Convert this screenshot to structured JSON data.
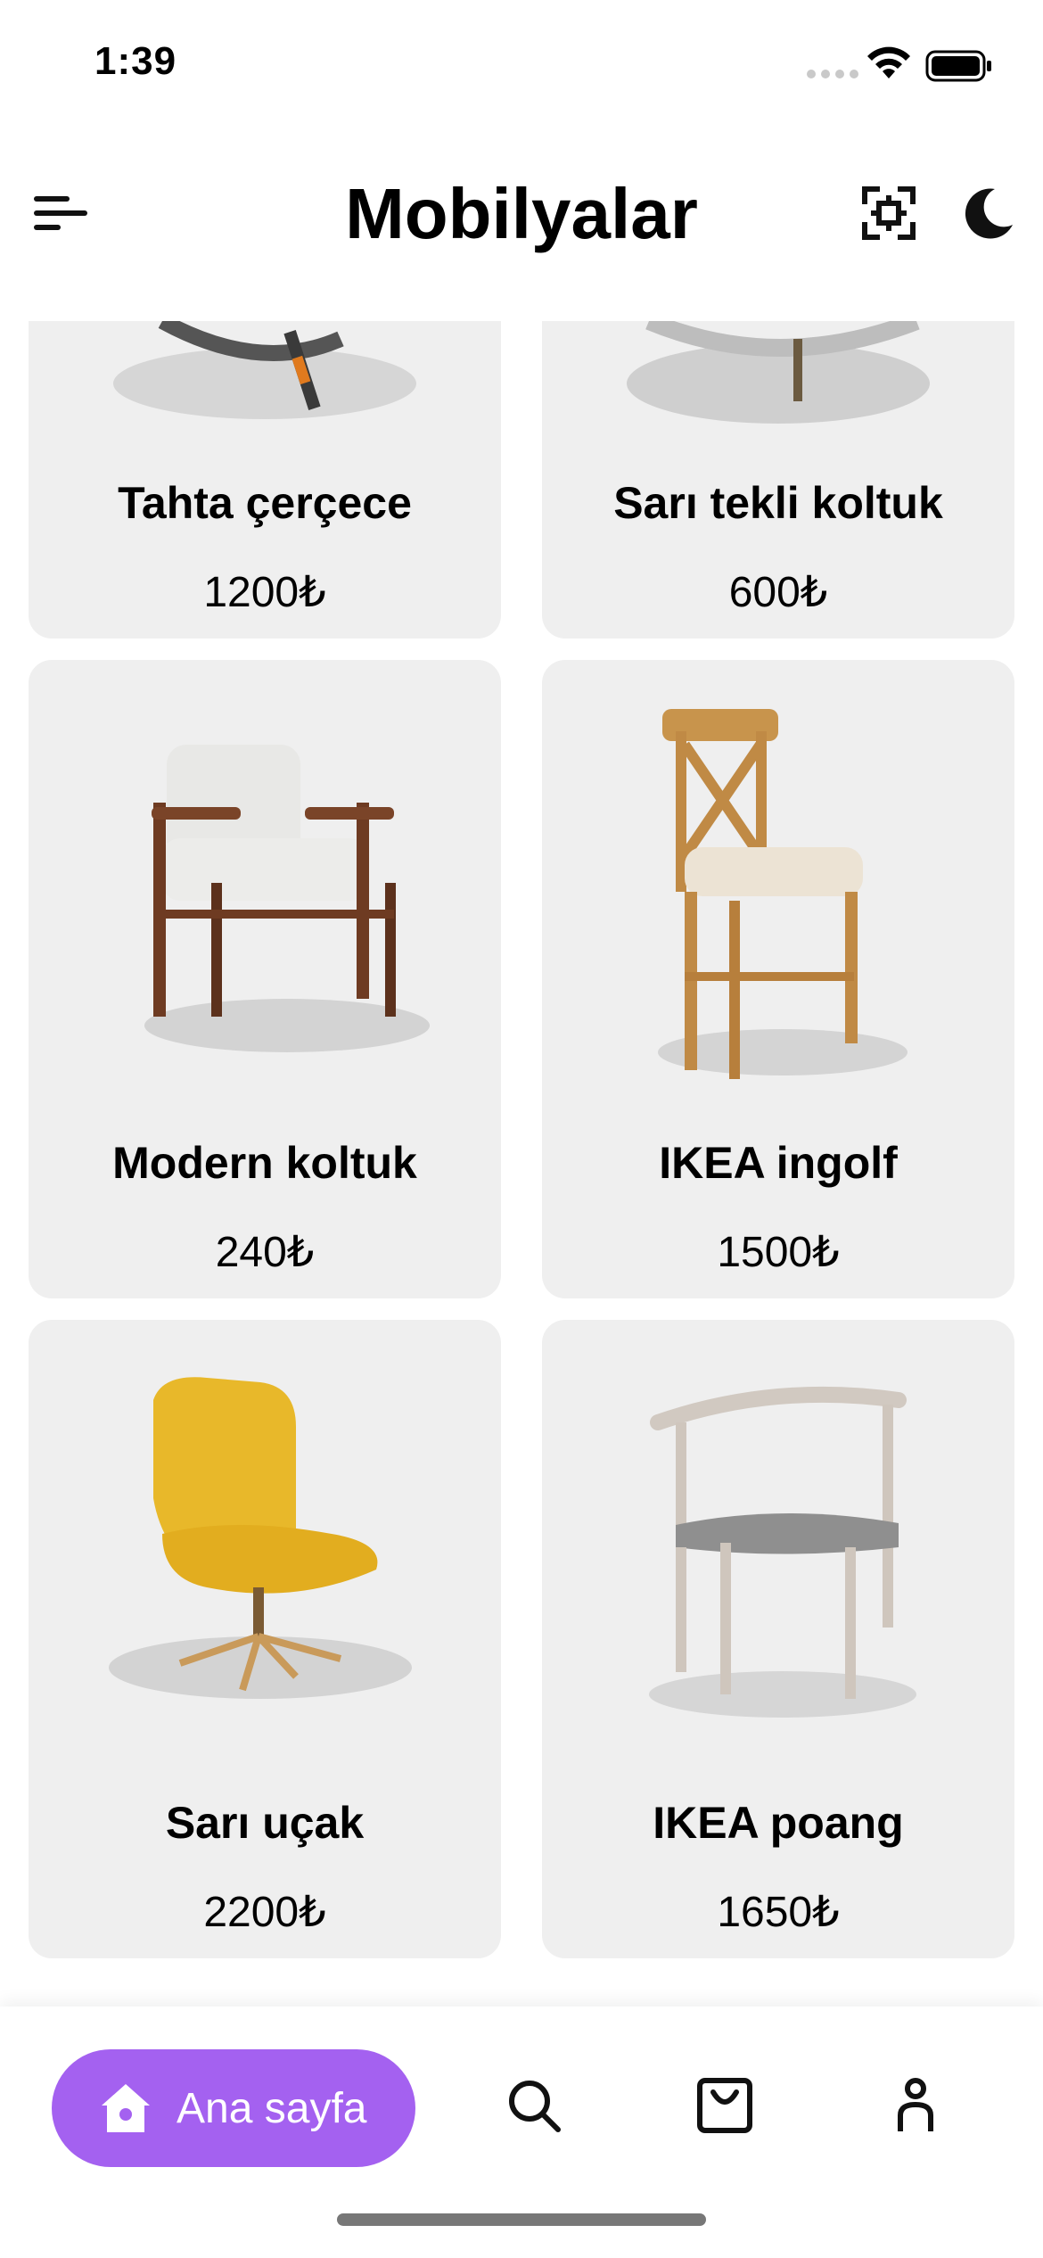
{
  "status_bar": {
    "time": "1:39"
  },
  "header": {
    "title": "Mobilyalar",
    "icons": {
      "menu": "menu-icon",
      "scan": "scan-icon",
      "theme": "moon-icon"
    }
  },
  "products": [
    {
      "name": "Tahta çerçece",
      "price": "1200₺",
      "image": "chair-partial-dark"
    },
    {
      "name": "Sarı tekli koltuk",
      "price": "600₺",
      "image": "chair-partial-gray"
    },
    {
      "name": "Modern koltuk",
      "price": "240₺",
      "image": "armchair-white-wood"
    },
    {
      "name": "IKEA ingolf",
      "price": "1500₺",
      "image": "wooden-chair-cushion"
    },
    {
      "name": "Sarı uçak",
      "price": "2200₺",
      "image": "yellow-lounge-chair"
    },
    {
      "name": "IKEA poang",
      "price": "1650₺",
      "image": "white-round-back-chair"
    }
  ],
  "bottom_nav": {
    "active_label": "Ana sayfa",
    "icons": [
      "home-icon",
      "search-icon",
      "shopping-bag-icon",
      "profile-icon"
    ]
  },
  "colors": {
    "accent": "#a461f0",
    "card_bg": "#efefef"
  }
}
